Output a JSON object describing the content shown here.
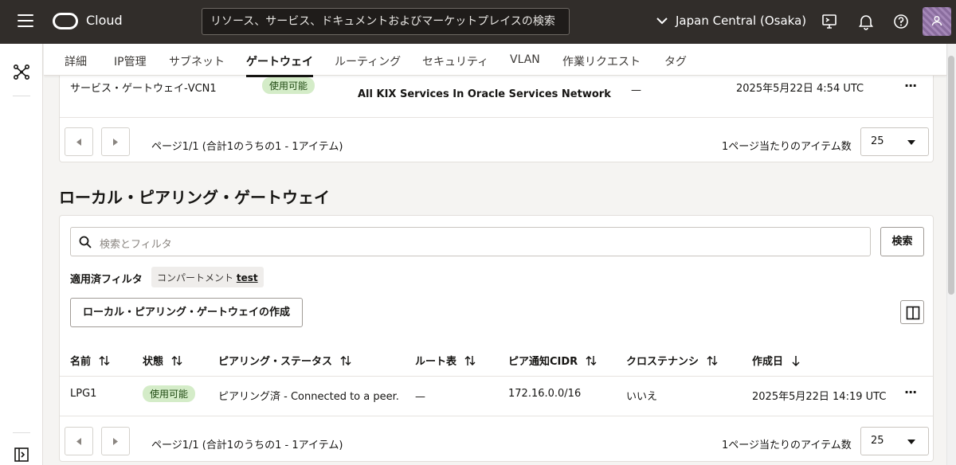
{
  "topbar": {
    "brand": "Cloud",
    "search_placeholder": "リソース、サービス、ドキュメントおよびマーケットプレイスの検索",
    "region": "Japan Central (Osaka)"
  },
  "tabs": [
    "詳細",
    "IP管理",
    "サブネット",
    "ゲートウェイ",
    "ルーティング",
    "セキュリティ",
    "VLAN",
    "作業リクエスト",
    "タグ"
  ],
  "active_tab": "ゲートウェイ",
  "service_gateway": {
    "row": {
      "name": "サービス・ゲートウェイ-VCN1",
      "status": "使用可能",
      "services": "All KIX Services In Oracle Services Network",
      "route_table": "—",
      "created": "2025年5月22日 4:54 UTC"
    },
    "pagination_text": "ページ1/1 (合計1のうちの1 - 1アイテム)",
    "per_page_label": "1ページ当たりのアイテム数",
    "per_page_value": "25"
  },
  "lpg_section": {
    "title": "ローカル・ピアリング・ゲートウェイ",
    "filter_placeholder": "検索とフィルタ",
    "search_button": "検索",
    "applied_filters_label": "適用済フィルタ",
    "chip_prefix": "コンパートメント",
    "chip_value": "test",
    "create_button": "ローカル・ピアリング・ゲートウェイの作成",
    "columns": [
      "名前",
      "状態",
      "ピアリング・ステータス",
      "ルート表",
      "ピア通知CIDR",
      "クロステナンシ",
      "作成日"
    ],
    "rows": [
      {
        "name": "LPG1",
        "status": "使用可能",
        "peering_status": "ピアリング済 - Connected to a peer.",
        "route_table": "—",
        "peer_cidr": "172.16.0.0/16",
        "cross_tenancy": "いいえ",
        "created": "2025年5月22日 14:19 UTC"
      }
    ],
    "pagination_text": "ページ1/1 (合計1のうちの1 - 1アイテム)",
    "per_page_label": "1ページ当たりのアイテム数",
    "per_page_value": "25"
  }
}
